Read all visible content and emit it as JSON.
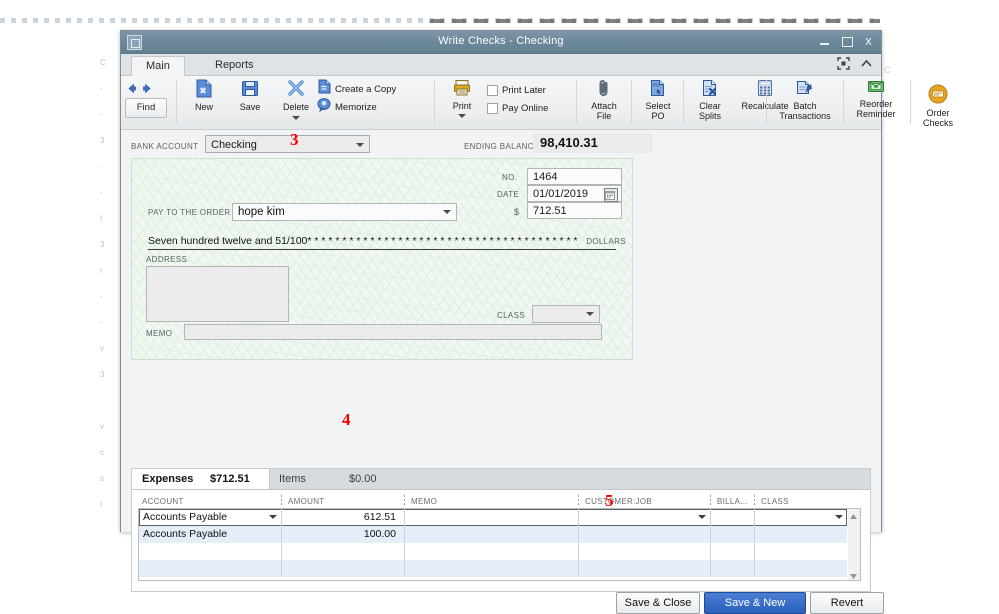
{
  "window": {
    "title": "Write Checks - Checking",
    "minimize_label": "Minimize",
    "maximize_label": "Maximize",
    "close_label": "x"
  },
  "ribbon": {
    "tabs": [
      {
        "label": "Main",
        "active": true
      },
      {
        "label": "Reports",
        "active": false
      }
    ],
    "expand_icon": "expand-icon",
    "collapse_icon": "chevron-up-icon",
    "nav": {
      "back": "back-arrow-icon",
      "forward": "forward-arrow-icon",
      "find_label": "Find"
    },
    "buttons": [
      {
        "label": "New",
        "icon": "new-document-icon"
      },
      {
        "label": "Save",
        "icon": "save-disk-icon"
      },
      {
        "label": "Delete",
        "icon": "delete-x-icon"
      },
      {
        "label": "Print",
        "icon": "printer-icon"
      },
      {
        "label": "Attach",
        "label2": "File",
        "icon": "paperclip-icon"
      },
      {
        "label": "Select",
        "label2": "PO",
        "icon": "select-po-icon"
      },
      {
        "label": "Clear",
        "label2": "Splits",
        "icon": "clear-splits-icon"
      },
      {
        "label": "Recalculate",
        "icon": "calculator-icon"
      },
      {
        "label": "Batch",
        "label2": "Transactions",
        "icon": "batch-transactions-icon"
      },
      {
        "label": "Reorder",
        "label2": "Reminder",
        "icon": "reorder-reminder-icon"
      },
      {
        "label": "Order",
        "label2": "Checks",
        "icon": "order-checks-icon"
      }
    ],
    "stacked": [
      {
        "label": "Create a Copy",
        "icon": "copy-icon"
      },
      {
        "label": "Memorize",
        "icon": "memorize-icon"
      }
    ],
    "checkboxes": [
      {
        "label": "Print Later",
        "checked": false
      },
      {
        "label": "Pay Online",
        "checked": false
      }
    ]
  },
  "account_row": {
    "bank_account_label": "BANK ACCOUNT",
    "bank_account_value": "Checking",
    "ending_balance_label": "ENDING BALANCE",
    "ending_balance_value": "98,410.31"
  },
  "check": {
    "no_label": "NO.",
    "no_value": "1464",
    "date_label": "DATE",
    "date_value": "01/01/2019",
    "date_picker_icon": "calendar-icon",
    "dollar_sign_label": "$",
    "amount_value": "712.51",
    "payee_label": "PAY TO THE ORDER OF",
    "payee_value": "hope kim",
    "amount_words": "Seven hundred twelve and 51/100* * * * * * * * * * * * * * * * * * * * * * * * * * * * * * * * * * * * * * *",
    "dollars_label": "DOLLARS",
    "address_label": "ADDRESS",
    "address_value": "",
    "memo_label": "MEMO",
    "memo_value": "",
    "class_label": "CLASS",
    "class_value": ""
  },
  "expenses": {
    "tabs": [
      {
        "label": "Expenses",
        "amount": "$712.51",
        "active": true
      },
      {
        "label": "Items",
        "amount": "$0.00",
        "active": false
      }
    ],
    "columns": [
      "ACCOUNT",
      "AMOUNT",
      "MEMO",
      "CUSTOMER:JOB",
      "BILLA...",
      "CLASS"
    ],
    "rows": [
      {
        "account": "Accounts Payable",
        "amount": "612.51",
        "memo": "",
        "customer_job": "",
        "billable": "",
        "class": "",
        "state": "active"
      },
      {
        "account": "Accounts Payable",
        "amount": "100.00",
        "memo": "",
        "customer_job": "",
        "billable": "",
        "class": "",
        "state": "alt"
      },
      {
        "account": "",
        "amount": "",
        "memo": "",
        "customer_job": "",
        "billable": "",
        "class": "",
        "state": "plain"
      },
      {
        "account": "",
        "amount": "",
        "memo": "",
        "customer_job": "",
        "billable": "",
        "class": "",
        "state": "alt"
      }
    ],
    "scroll_up_icon": "scroll-up-arrow-icon",
    "scroll_down_icon": "scroll-down-arrow-icon"
  },
  "footer": {
    "save_close": "Save & Close",
    "save_new": "Save & New",
    "revert": "Revert"
  },
  "annotations": [
    {
      "number": "3",
      "target": "bank-account-select"
    },
    {
      "number": "4",
      "target": "expense-amount-cell"
    },
    {
      "number": "5",
      "target": "save-close-button"
    }
  ],
  "colors": {
    "titlebar": "#6d889d",
    "primary_button": "#2a5fba",
    "check_bg": "#f1f8f1",
    "annotation": "#fb0000",
    "row_alt": "#e4edf8"
  }
}
